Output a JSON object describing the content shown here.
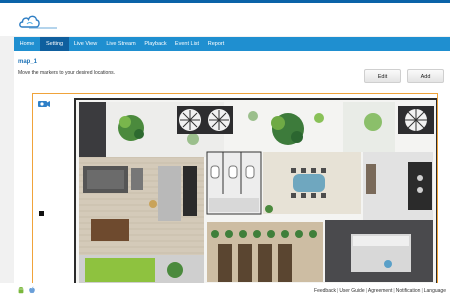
{
  "nav": {
    "items": [
      {
        "label": "Home"
      },
      {
        "label": "Setting"
      },
      {
        "label": "Live View"
      },
      {
        "label": "Live Stream"
      },
      {
        "label": "Playback"
      },
      {
        "label": "Event List"
      },
      {
        "label": "Report"
      }
    ],
    "active_index": 1
  },
  "map": {
    "title": "map_1",
    "instructions": "Move the markers to your desired locations."
  },
  "buttons": {
    "edit_label": "Edit",
    "add_label": "Add"
  },
  "footer": {
    "links": [
      "Feedback",
      "User Guide",
      "Agreement",
      "Notification",
      "Language"
    ],
    "icons": [
      "android-icon",
      "apple-icon"
    ]
  },
  "colors": {
    "nav_bg": "#1f8fd0",
    "nav_active": "#0f5f9e",
    "title_blue": "#1f73b7",
    "canvas_border": "#f0a33a"
  }
}
